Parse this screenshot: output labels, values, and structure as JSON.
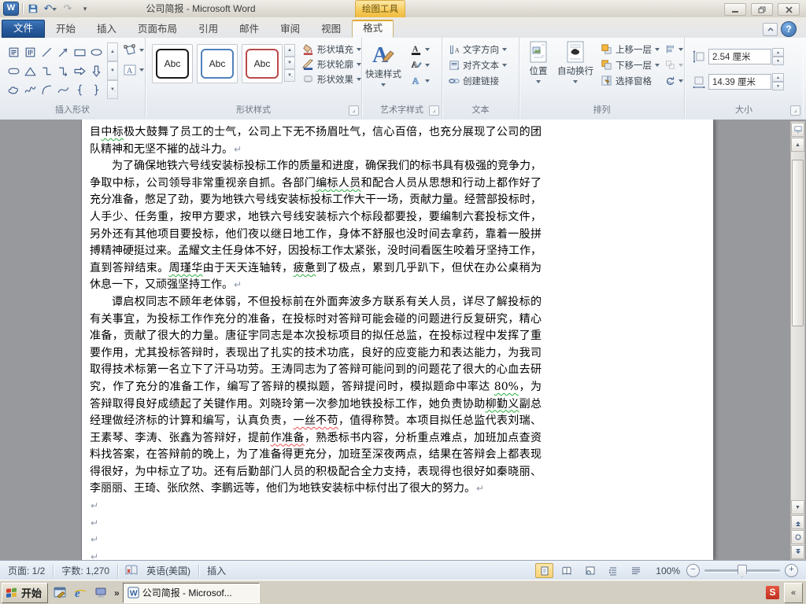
{
  "titlebar": {
    "title": "公司简报 - Microsoft Word",
    "contextual_group_label": "绘图工具",
    "qat_icons": [
      "word-logo",
      "save",
      "undo",
      "redo",
      "customize-quick-access"
    ]
  },
  "tabs": [
    {
      "label": "文件",
      "type": "file"
    },
    {
      "label": "开始"
    },
    {
      "label": "插入"
    },
    {
      "label": "页面布局"
    },
    {
      "label": "引用"
    },
    {
      "label": "邮件"
    },
    {
      "label": "审阅"
    },
    {
      "label": "视图"
    },
    {
      "label": "格式",
      "active": true,
      "contextual": true
    }
  ],
  "ribbon": {
    "insert_shapes": {
      "label": "插入形状",
      "shapes": [
        "text-box",
        "vertical-text-box",
        "line",
        "arrow",
        "rectangle",
        "oval",
        "rounded-rectangle",
        "triangle",
        "elbow-connector",
        "elbow-arrow",
        "right-arrow",
        "down-arrow",
        "cloud",
        "scribble",
        "arc",
        "curve",
        "left-brace",
        "right-brace"
      ]
    },
    "shape_styles": {
      "label": "形状样式",
      "preview_label": "Abc",
      "style_colors": [
        "#1a1a1a",
        "#4f81bd",
        "#b94a48"
      ],
      "buttons": [
        {
          "label": "形状填充"
        },
        {
          "label": "形状轮廓"
        },
        {
          "label": "形状效果"
        }
      ]
    },
    "wordart": {
      "label": "艺术字样式",
      "quick_styles": "快速样式"
    },
    "text_group": {
      "label": "文本",
      "items": [
        {
          "label": "文字方向"
        },
        {
          "label": "对齐文本"
        },
        {
          "label": "创建链接"
        }
      ]
    },
    "arrange": {
      "label": "排列",
      "position": "位置",
      "wrap": "自动换行",
      "items": [
        {
          "label": "上移一层"
        },
        {
          "label": "下移一层"
        },
        {
          "label": "选择窗格"
        }
      ]
    },
    "size": {
      "label": "大小",
      "height_value": "2.54 厘米",
      "width_value": "14.39 厘米"
    }
  },
  "document": {
    "lines": [
      {
        "segs": [
          [
            "目",
            ""
          ],
          [
            "中标",
            "g"
          ],
          [
            "极大鼓舞了员工的士气，公司上下无不扬眉吐气，信心百倍，也充分展现了公司的团",
            ""
          ]
        ],
        "just": true
      },
      {
        "segs": [
          [
            "队精神和无坚不摧的战斗力。",
            ""
          ]
        ],
        "end": true
      },
      {
        "ind": true,
        "segs": [
          [
            "为了确保地铁六号线安装标投标工作的质量和进度，确保我们的标书具有极强的竞争力，",
            ""
          ]
        ],
        "just": true
      },
      {
        "segs": [
          [
            "争取中标，公司领导非常重视亲自抓。各部门",
            ""
          ],
          [
            "编标人员",
            "g"
          ],
          [
            "和配合人员从思想和行动上都作好了",
            ""
          ]
        ],
        "just": true
      },
      {
        "segs": [
          [
            "充分准备，憋足了劲，要为地铁六号线安装标投标工作大干一场，贡献力量。经营部投标时，",
            ""
          ]
        ],
        "just": true
      },
      {
        "segs": [
          [
            "人手少、任务重，按甲方要求，地铁六号线安装标六个标段都要投，要编制六套投标文件，",
            ""
          ]
        ],
        "just": true
      },
      {
        "segs": [
          [
            "另外还有其他项目要投标，他们夜以继日地工作，身体不舒服也没时间去拿药，靠着一股拼",
            ""
          ]
        ],
        "just": true
      },
      {
        "segs": [
          [
            "搏精神硬挺过来。孟耀文主任身体不好，因投标工作太紧张，没时间看医生咬着牙坚持工作，",
            ""
          ]
        ],
        "just": true
      },
      {
        "segs": [
          [
            "直到答辩结束。",
            ""
          ],
          [
            "周瑾华",
            "g"
          ],
          [
            "由于天天连轴转，",
            ""
          ],
          [
            "疲惫",
            "g"
          ],
          [
            "到了极点，累到几乎趴下，但伏在办公桌稍为",
            ""
          ]
        ],
        "just": true
      },
      {
        "segs": [
          [
            "休息一下，又顽强坚持工作。",
            ""
          ]
        ],
        "end": true
      },
      {
        "ind": true,
        "segs": [
          [
            "谭启权同志不顾年老体弱，不但投标前在外面奔波多方联系有关人员，详尽了解投标的",
            ""
          ]
        ],
        "just": true
      },
      {
        "segs": [
          [
            "有关事宜，为投标工作作充分的准备，在投标时对答辩可能会碰的问题进行反复研究，精心",
            ""
          ]
        ],
        "just": true
      },
      {
        "segs": [
          [
            "准备，贡献了很大的力量。唐征宇同志是本次投标项目的拟任总监，在投标过程中发挥了重",
            ""
          ]
        ],
        "just": true
      },
      {
        "segs": [
          [
            "要作用，尤其投标答辩时，表现出了扎实的技术功底，良好的应变能力和表达能力，为我司",
            ""
          ]
        ],
        "just": true
      },
      {
        "segs": [
          [
            "取得技术标第一名立下了汗马功劳。王涛同志为了答辩可能问到的问题花了很大的心血去研",
            ""
          ]
        ],
        "just": true
      },
      {
        "segs": [
          [
            "究，作了充分的准备工作，编写了答辩的模拟题，答辩提问时，模拟题命中率达 ",
            ""
          ],
          [
            "80%",
            "g"
          ],
          [
            "，为",
            ""
          ]
        ],
        "just": true
      },
      {
        "segs": [
          [
            "答辩取得良好成绩起了关键作用。刘晓玲第一次参加地铁投标工作，她负责协助",
            ""
          ],
          [
            "柳勤义",
            "g"
          ],
          [
            "副总",
            ""
          ]
        ],
        "just": true
      },
      {
        "segs": [
          [
            "经理做经济标的计算和编写，认真负责，",
            ""
          ],
          [
            "一丝不苟",
            "r"
          ],
          [
            "，值得称赞。本项目拟任总监代表刘瑞、",
            ""
          ]
        ],
        "just": true
      },
      {
        "segs": [
          [
            "王素琴、李涛、张鑫为答辩好，提前",
            ""
          ],
          [
            "作准备",
            "r"
          ],
          [
            "，熟悉标书内容，分析重点难点，加班加点查资",
            ""
          ]
        ],
        "just": true
      },
      {
        "segs": [
          [
            "料找答案，在答辩前的晚上，为了准备得更充分，加班至深夜两点，结果在答辩会上都表现",
            ""
          ]
        ],
        "just": true
      },
      {
        "segs": [
          [
            "得很好，为中标立了功。还有后勤部门人员的积极配合全力支持，表现得也很好如秦晓丽、",
            ""
          ]
        ],
        "just": true
      },
      {
        "segs": [
          [
            "李丽丽、王琦、张欣然、李鹏远等，他们为地铁安装标中标付出了很大的努力。",
            ""
          ]
        ],
        "end": true
      },
      {
        "segs": [],
        "end": true
      },
      {
        "segs": [],
        "end": true
      },
      {
        "segs": [],
        "end": true
      },
      {
        "segs": [],
        "end": true
      }
    ]
  },
  "status": {
    "page": "页面: 1/2",
    "words": "字数: 1,270",
    "language": "英语(美国)",
    "mode": "插入",
    "zoom": "100%"
  },
  "taskbar": {
    "start": "开始",
    "overflow": "»",
    "task": "公司简报 - Microsof...",
    "tray_icon": "S",
    "tray_collapse": "«"
  }
}
